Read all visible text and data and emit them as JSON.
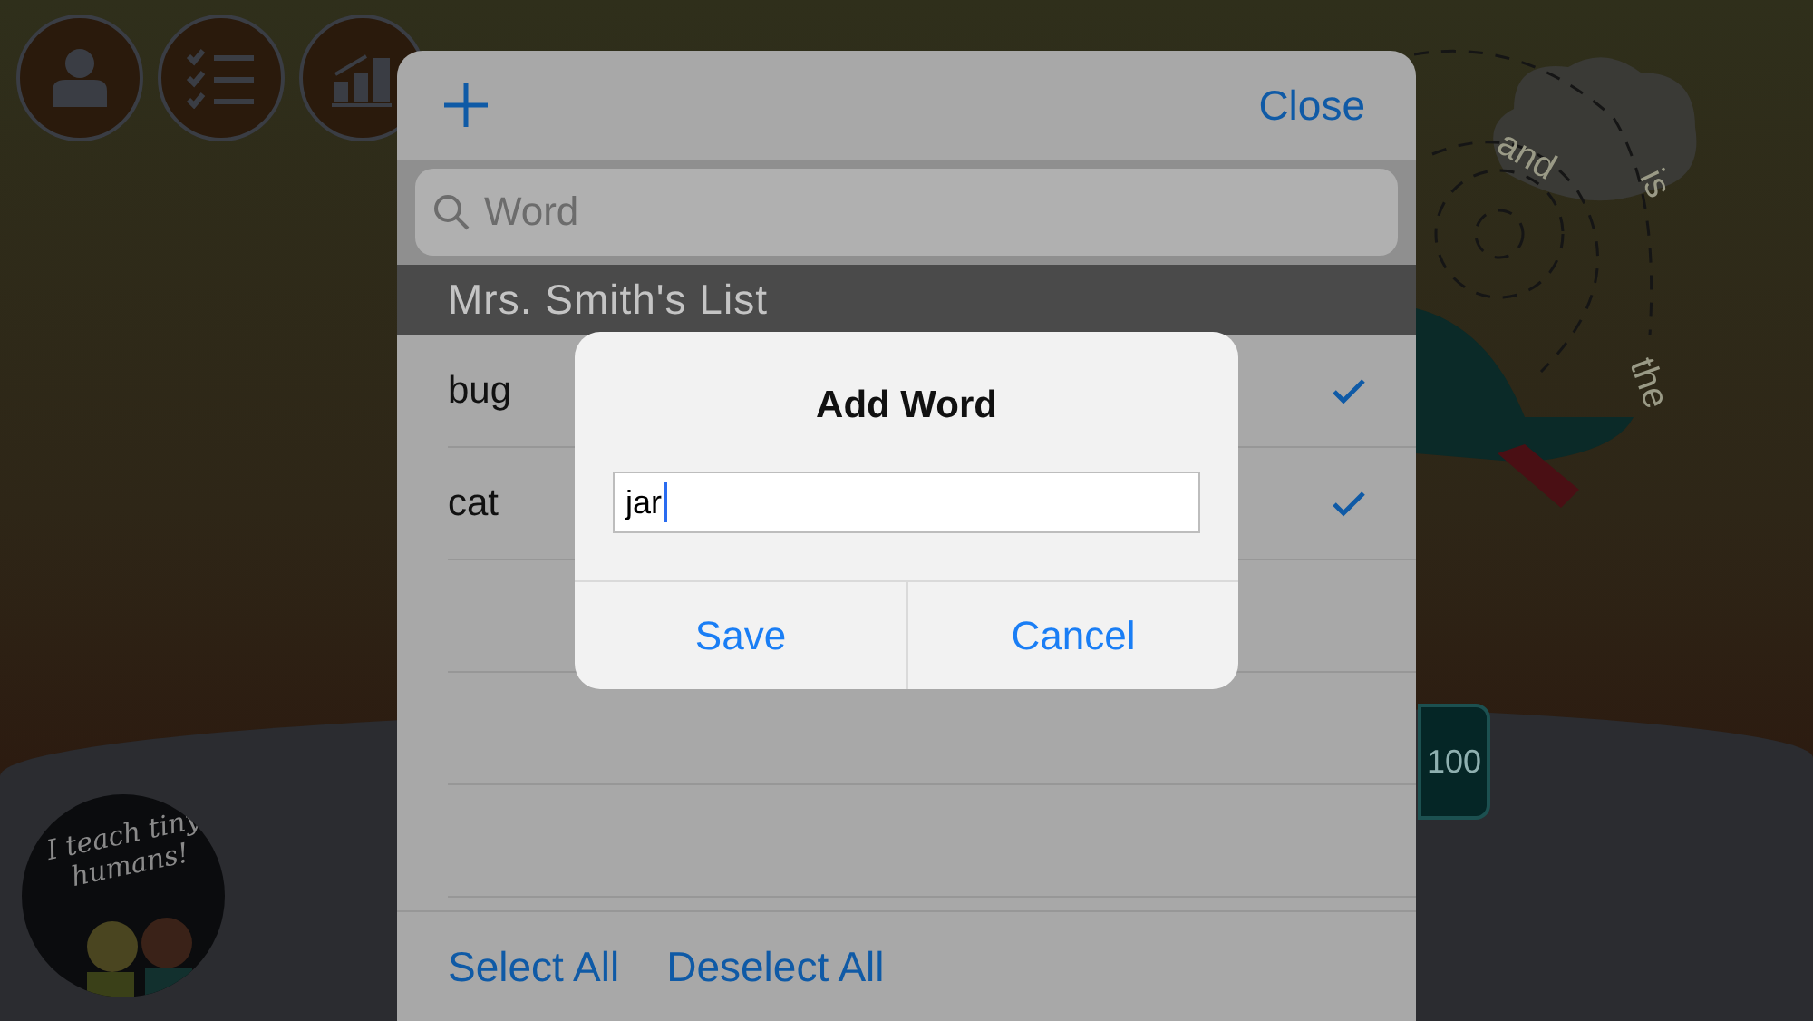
{
  "game_background": {
    "menu_buttons": [
      {
        "kind": "profile"
      },
      {
        "kind": "checklist"
      },
      {
        "kind": "chart"
      }
    ],
    "path_words": [
      "and",
      "is",
      "the"
    ],
    "sign": "100",
    "logo": "I teach tiny humans!"
  },
  "word_list": {
    "close": "Close",
    "search": {
      "placeholder": "Word"
    },
    "section_title": "Mrs. Smith's List",
    "rows": [
      {
        "word": "bug",
        "checked": true
      },
      {
        "word": "cat",
        "checked": true
      }
    ],
    "footer": [
      "Select All",
      "Deselect All"
    ]
  },
  "dialog": {
    "title": "Add Word",
    "value": "jar",
    "buttons": [
      "Save",
      "Cancel"
    ]
  }
}
